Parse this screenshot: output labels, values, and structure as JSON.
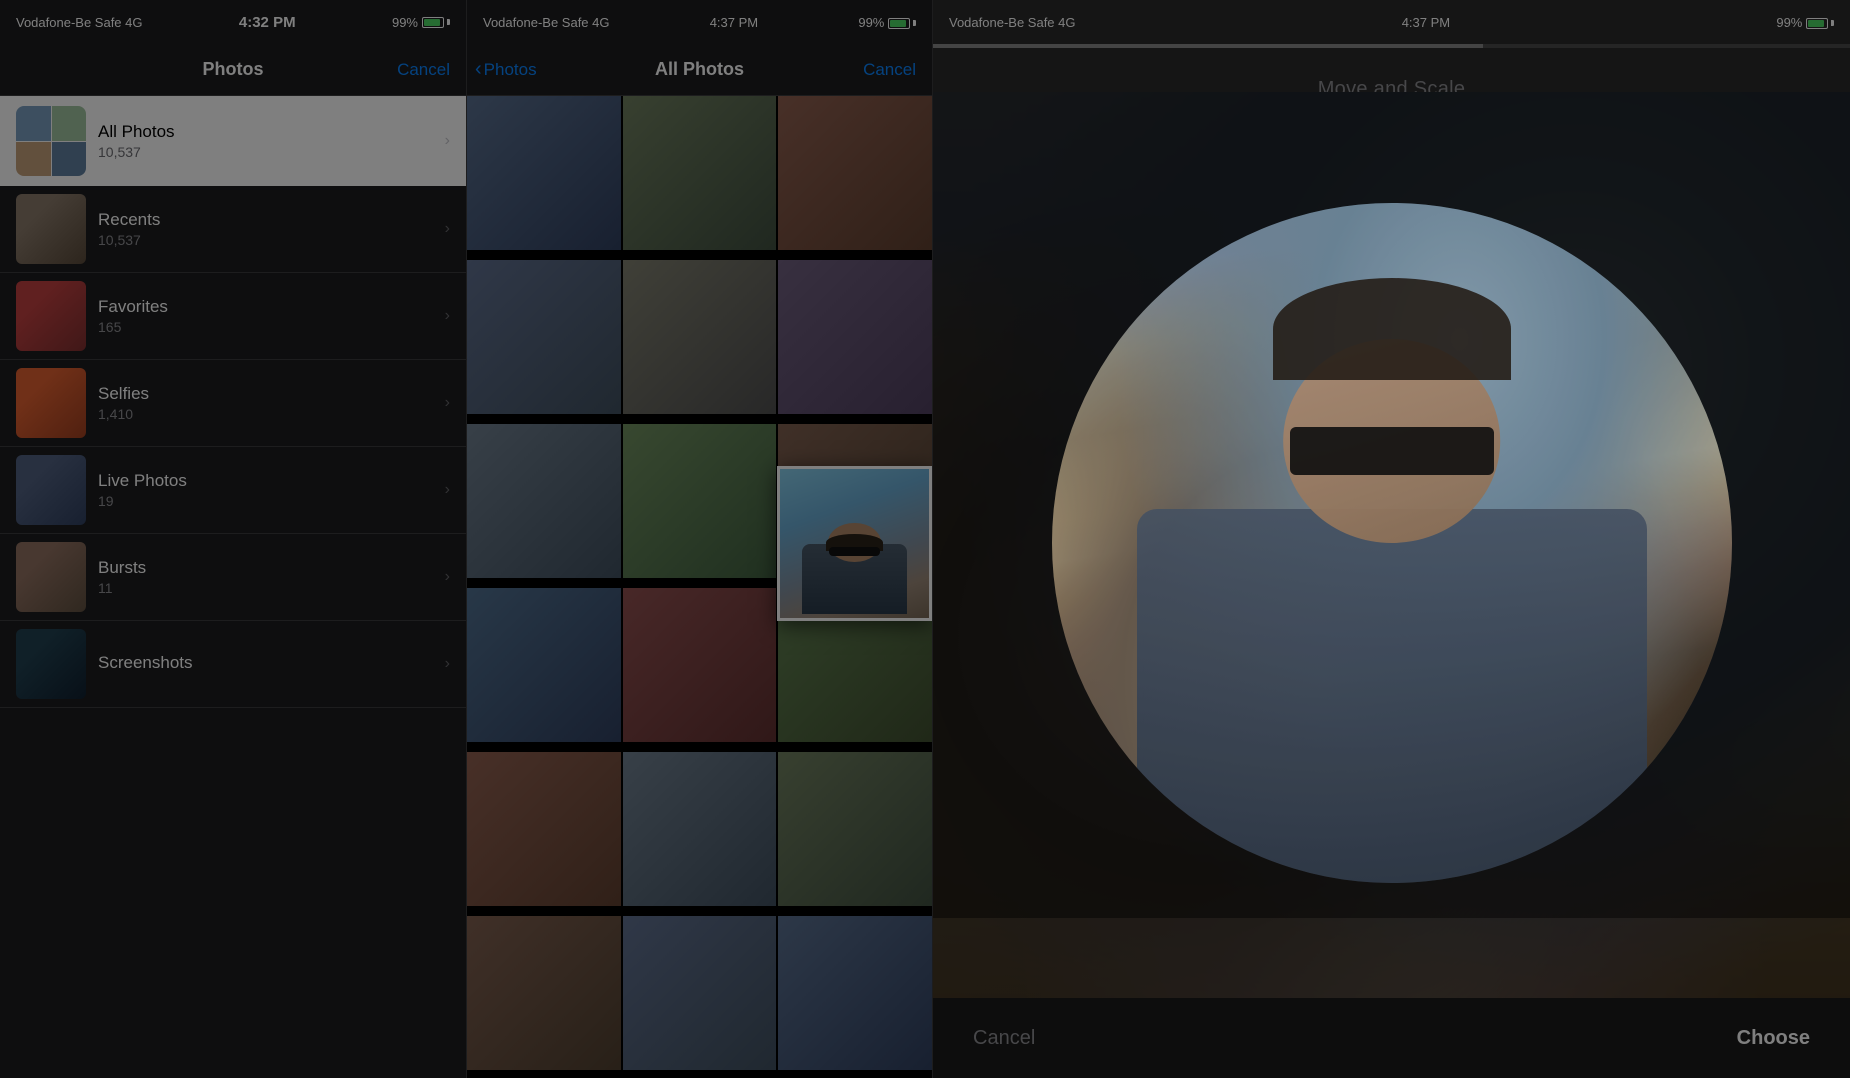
{
  "panel1": {
    "status": {
      "carrier": "Vodafone-Be Safe  4G",
      "time": "4:32 PM",
      "battery": "99%"
    },
    "header": {
      "title": "Photos",
      "cancel": "Cancel"
    },
    "allPhotos": {
      "title": "All Photos",
      "count": "10,537"
    },
    "albums": [
      {
        "name": "Recents",
        "count": "10,537",
        "colorClass": "thumb-recents"
      },
      {
        "name": "Favorites",
        "count": "165",
        "colorClass": "thumb-favorites"
      },
      {
        "name": "Selfies",
        "count": "1,410",
        "colorClass": "thumb-selfies"
      },
      {
        "name": "Live Photos",
        "count": "19",
        "colorClass": "thumb-live"
      },
      {
        "name": "Bursts",
        "count": "11",
        "colorClass": "thumb-bursts"
      },
      {
        "name": "Screenshots",
        "count": "",
        "colorClass": "thumb-screenshots"
      }
    ]
  },
  "panel2": {
    "status": {
      "carrier": "Vodafone-Be Safe  4G",
      "time": "4:37 PM",
      "battery": "99%"
    },
    "header": {
      "back": "Photos",
      "title": "All Photos",
      "cancel": "Cancel"
    }
  },
  "panel3": {
    "status": {
      "carrier": "Vodafone-Be Safe  4G",
      "time": "4:37 PM",
      "battery": "99%"
    },
    "title": "Move and Scale",
    "cancel": "Cancel",
    "choose": "Choose"
  }
}
